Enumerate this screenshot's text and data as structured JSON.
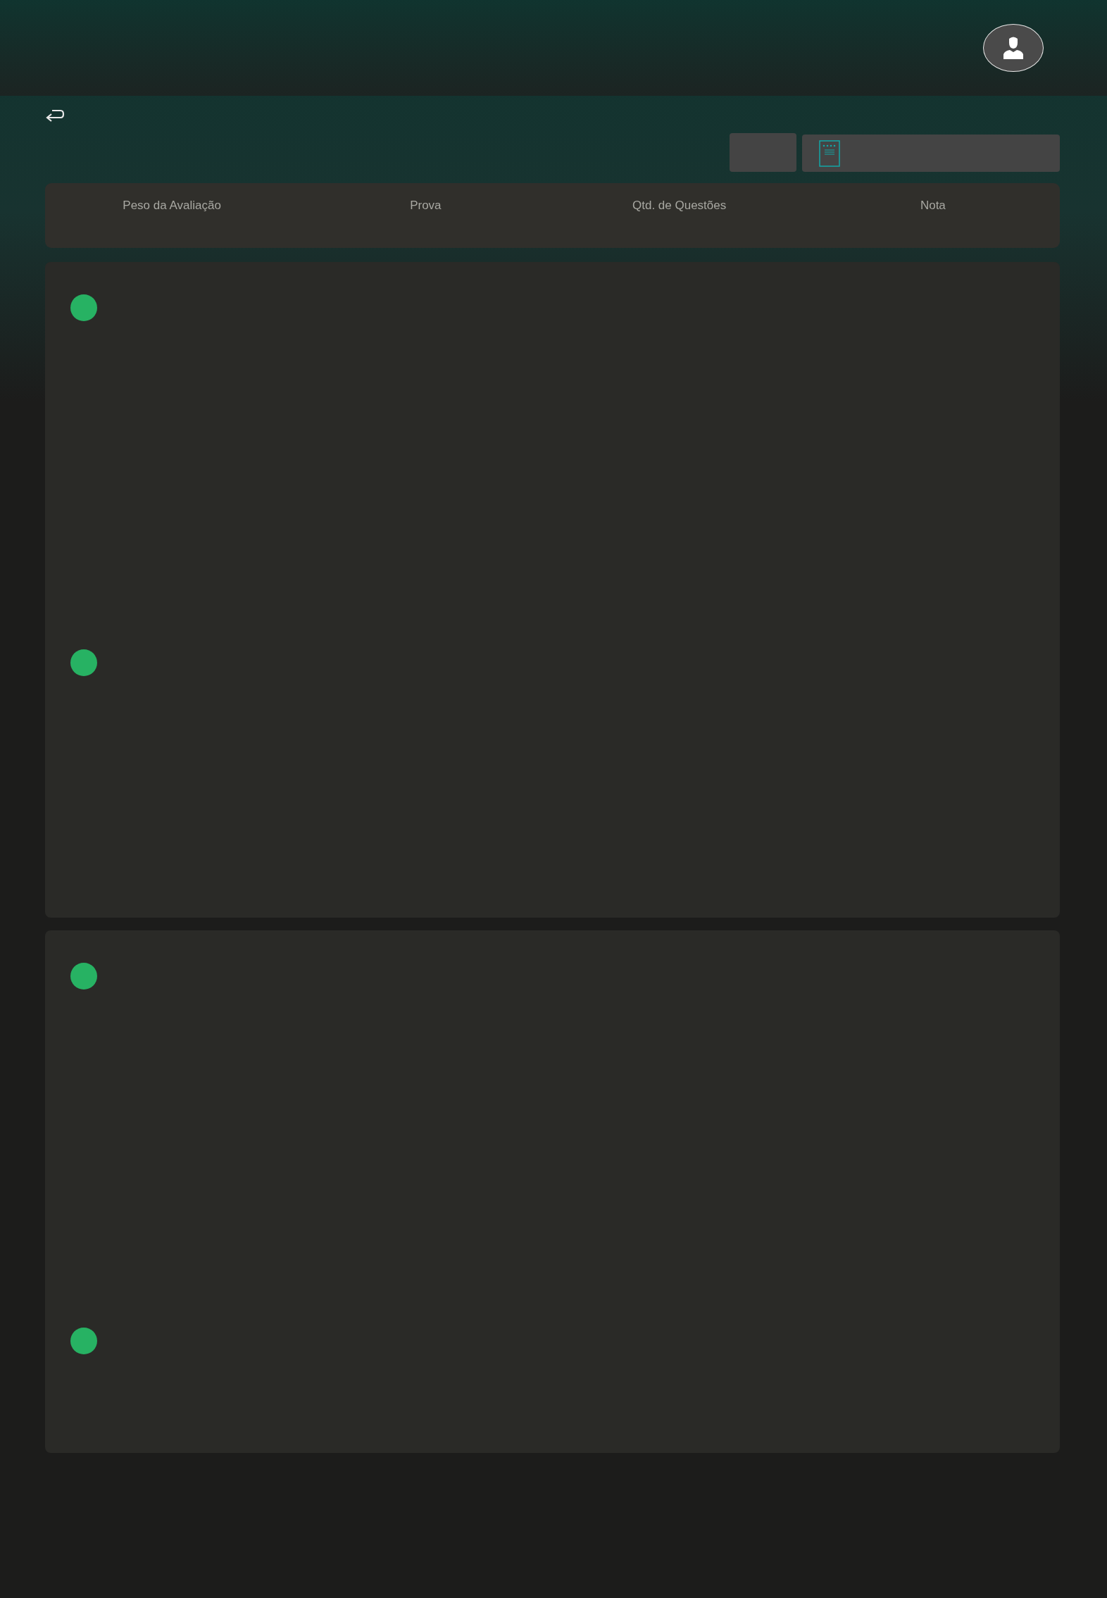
{
  "table": {
    "columns": [
      "Peso da Avaliação",
      "Prova",
      "Qtd. de Questões",
      "Nota"
    ]
  },
  "cards": [
    {
      "rows": [
        {
          "kind": "status"
        },
        {
          "kind": "status"
        }
      ]
    },
    {
      "rows": [
        {
          "kind": "status"
        },
        {
          "kind": "status"
        }
      ]
    }
  ]
}
